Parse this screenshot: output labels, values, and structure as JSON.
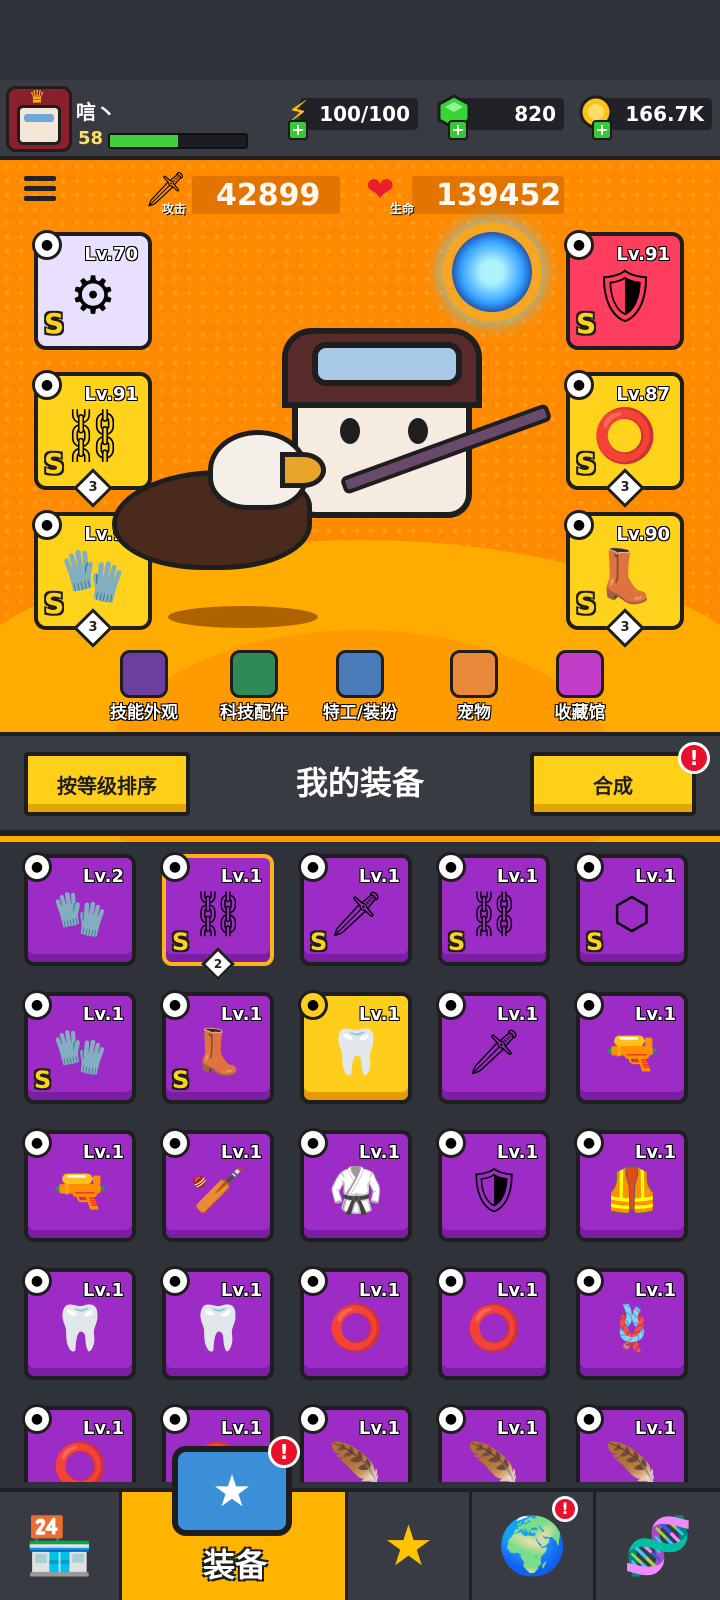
{
  "player": {
    "name": "唁丶",
    "level": "58",
    "xp_fraction": 0.5
  },
  "resources": {
    "energy": "100/100",
    "gems": "820",
    "coins": "166.7K"
  },
  "stats": {
    "attack_label": "攻击",
    "attack_value": "42899",
    "hp_label": "生命",
    "hp_value": "139452"
  },
  "equipped": [
    {
      "slot": "weapon",
      "level": "Lv.70",
      "grade": "S",
      "icon": "gear-staff-icon",
      "color": "#e9e0ff",
      "stack": ""
    },
    {
      "slot": "necklace",
      "level": "Lv.91",
      "grade": "S",
      "icon": "chain-necklace-icon",
      "color": "#ffd21c",
      "stack": "3"
    },
    {
      "slot": "gloves",
      "level": "Lv.91",
      "grade": "S",
      "icon": "gauntlet-icon",
      "color": "#ffd21c",
      "stack": "3"
    },
    {
      "slot": "armor",
      "level": "Lv.91",
      "grade": "S",
      "icon": "armor-icon",
      "color": "#ff3d5e",
      "stack": ""
    },
    {
      "slot": "belt",
      "level": "Lv.87",
      "grade": "S",
      "icon": "ring-belt-icon",
      "color": "#ffd21c",
      "stack": "3"
    },
    {
      "slot": "boots",
      "level": "Lv.90",
      "grade": "S",
      "icon": "boot-icon",
      "color": "#ffd21c",
      "stack": "3"
    }
  ],
  "tabs": [
    {
      "label": "技能外观",
      "icon": "skill-skin-icon",
      "color": "#6b3fa0"
    },
    {
      "label": "科技配件",
      "icon": "tech-part-icon",
      "color": "#2e8b57"
    },
    {
      "label": "特工/装扮",
      "icon": "agent-outfit-icon",
      "color": "#4a7ab8"
    },
    {
      "label": "宠物",
      "icon": "pet-icon",
      "color": "#e9893a"
    },
    {
      "label": "收藏馆",
      "icon": "collection-icon",
      "color": "#c43dc9"
    }
  ],
  "toolbar": {
    "sort_label": "按等级排序",
    "title": "我的装备",
    "merge_label": "合成",
    "merge_alert": "!"
  },
  "inventory": [
    {
      "level": "Lv.2",
      "grade": "",
      "icon": "gauntlet-icon",
      "glyph": "🧤",
      "gold": false,
      "stack": ""
    },
    {
      "level": "Lv.1",
      "grade": "S",
      "icon": "chain-necklace-icon",
      "glyph": "⛓",
      "gold": false,
      "stack": "2",
      "selected": true
    },
    {
      "level": "Lv.1",
      "grade": "S",
      "icon": "flame-sword-icon",
      "glyph": "🗡",
      "gold": false,
      "stack": ""
    },
    {
      "level": "Lv.1",
      "grade": "S",
      "icon": "chain-necklace-icon",
      "glyph": "⛓",
      "gold": false,
      "stack": ""
    },
    {
      "level": "Lv.1",
      "grade": "S",
      "icon": "winged-belt-icon",
      "glyph": "⬡",
      "gold": false,
      "stack": ""
    },
    {
      "level": "Lv.1",
      "grade": "S",
      "icon": "gauntlet-icon",
      "glyph": "🧤",
      "gold": false,
      "stack": ""
    },
    {
      "level": "Lv.1",
      "grade": "S",
      "icon": "boot-icon",
      "glyph": "👢",
      "gold": false,
      "stack": ""
    },
    {
      "level": "Lv.1",
      "grade": "",
      "icon": "fang-necklace-icon",
      "glyph": "🦷",
      "gold": true,
      "stack": ""
    },
    {
      "level": "Lv.1",
      "grade": "",
      "icon": "katana-icon",
      "glyph": "🗡",
      "gold": false,
      "stack": ""
    },
    {
      "level": "Lv.1",
      "grade": "",
      "icon": "revolver-icon",
      "glyph": "🔫",
      "gold": false,
      "stack": ""
    },
    {
      "level": "Lv.1",
      "grade": "",
      "icon": "shotgun-icon",
      "glyph": "🔫",
      "gold": false,
      "stack": ""
    },
    {
      "level": "Lv.1",
      "grade": "",
      "icon": "torch-club-icon",
      "glyph": "🏏",
      "gold": false,
      "stack": ""
    },
    {
      "level": "Lv.1",
      "grade": "",
      "icon": "leaf-armor-icon",
      "glyph": "🥋",
      "gold": false,
      "stack": ""
    },
    {
      "level": "Lv.1",
      "grade": "",
      "icon": "plate-armor-icon",
      "glyph": "🛡",
      "gold": false,
      "stack": ""
    },
    {
      "level": "Lv.1",
      "grade": "",
      "icon": "vest-armor-icon",
      "glyph": "🦺",
      "gold": false,
      "stack": ""
    },
    {
      "level": "Lv.1",
      "grade": "",
      "icon": "fang-necklace-icon",
      "glyph": "🦷",
      "gold": false,
      "stack": ""
    },
    {
      "level": "Lv.1",
      "grade": "",
      "icon": "fang-necklace-icon",
      "glyph": "🦷",
      "gold": false,
      "stack": ""
    },
    {
      "level": "Lv.1",
      "grade": "",
      "icon": "spiked-collar-icon",
      "glyph": "⭕",
      "gold": false,
      "stack": ""
    },
    {
      "level": "Lv.1",
      "grade": "",
      "icon": "spiked-collar-icon",
      "glyph": "⭕",
      "gold": false,
      "stack": ""
    },
    {
      "level": "Lv.1",
      "grade": "",
      "icon": "rope-belt-icon",
      "glyph": "🪢",
      "gold": false,
      "stack": ""
    },
    {
      "level": "Lv.1",
      "grade": "",
      "icon": "metal-belt-icon",
      "glyph": "⭕",
      "gold": false,
      "stack": ""
    },
    {
      "level": "Lv.1",
      "grade": "",
      "icon": "belt-icon",
      "glyph": "⭕",
      "gold": false,
      "stack": ""
    },
    {
      "level": "Lv.1",
      "grade": "",
      "icon": "feather-glove-icon",
      "glyph": "🪶",
      "gold": false,
      "stack": ""
    },
    {
      "level": "Lv.1",
      "grade": "",
      "icon": "feather-glove-icon",
      "glyph": "🪶",
      "gold": false,
      "stack": ""
    },
    {
      "level": "Lv.1",
      "grade": "",
      "icon": "feather-glove-icon",
      "glyph": "🪶",
      "gold": false,
      "stack": ""
    }
  ],
  "bottom_nav": [
    {
      "icon": "shop-icon",
      "label": ""
    },
    {
      "icon": "equipment-icon",
      "label": "装备",
      "alert": "!"
    },
    {
      "icon": "battle-star-icon",
      "label": ""
    },
    {
      "icon": "planet-icon",
      "label": "",
      "alert": "!"
    },
    {
      "icon": "dna-capsule-icon",
      "label": ""
    }
  ]
}
